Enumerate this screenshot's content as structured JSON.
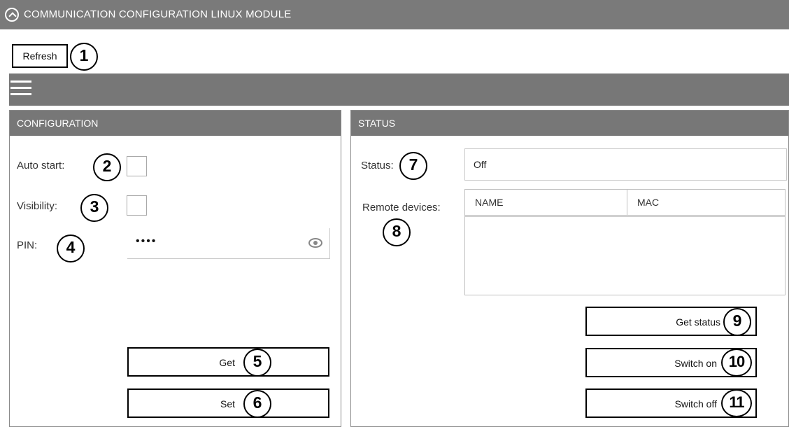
{
  "window": {
    "title": "COMMUNICATION CONFIGURATION LINUX MODULE"
  },
  "toolbar": {
    "refresh_label": "Refresh"
  },
  "configuration": {
    "header": "CONFIGURATION",
    "auto_start_label": "Auto start:",
    "visibility_label": "Visibility:",
    "pin_label": "PIN:",
    "pin_value": "••••",
    "auto_start_checked": false,
    "visibility_checked": false,
    "get_label": "Get",
    "set_label": "Set"
  },
  "status": {
    "header": "STATUS",
    "status_label": "Status:",
    "status_value": "Off",
    "remote_devices_label": "Remote devices:",
    "table_columns": [
      "NAME",
      "MAC"
    ],
    "table_rows": [],
    "get_status_label": "Get status",
    "switch_on_label": "Switch on",
    "switch_off_label": "Switch off"
  },
  "callouts": [
    "1",
    "2",
    "3",
    "4",
    "5",
    "6",
    "7",
    "8",
    "9",
    "10",
    "11"
  ],
  "colors": {
    "header_bg": "#777777",
    "title_bg": "#7a7a7a",
    "border": "#8a8a8a"
  },
  "icons": {
    "title": "app-circle-icon",
    "menu": "hamburger-menu-icon",
    "pin": "eye-icon"
  }
}
